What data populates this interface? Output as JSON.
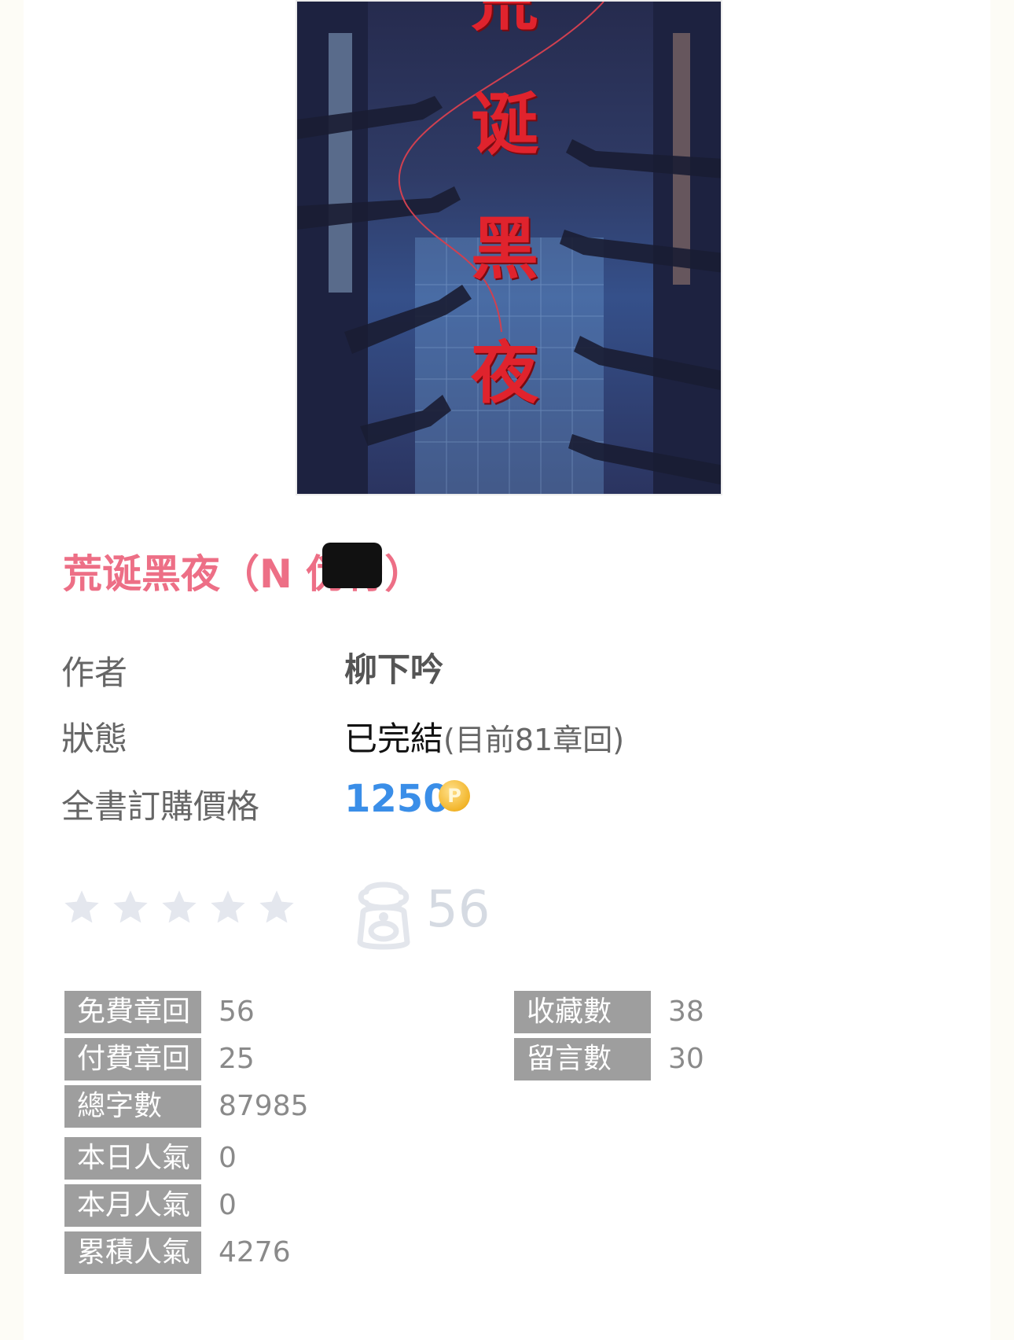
{
  "book": {
    "cover_title_chars": [
      "荒",
      "诞",
      "黑",
      "夜"
    ],
    "title": "荒诞黑夜（N 伪骨）"
  },
  "info": {
    "author_label": "作者",
    "author": "柳下吟",
    "status_label": "狀態",
    "status": "已完結",
    "status_detail": "(目前81章回)",
    "price_label": "全書訂購價格",
    "price": "1250",
    "coin_icon": "coin-icon",
    "coin_glyph": "P"
  },
  "rating": {
    "stars_filled": 0,
    "stars_total": 5,
    "favorite_count": "56"
  },
  "stats": {
    "left": [
      {
        "label": "免費章回",
        "value": "56"
      },
      {
        "label": "付費章回",
        "value": "25"
      },
      {
        "label": "總字數",
        "value": "87985"
      },
      {
        "label": "本日人氣",
        "value": "0"
      },
      {
        "label": "本月人氣",
        "value": "0"
      },
      {
        "label": "累積人氣",
        "value": "4276"
      }
    ],
    "right": [
      {
        "label": "收藏數",
        "value": "38"
      },
      {
        "label": "留言數",
        "value": "30"
      }
    ]
  },
  "colors": {
    "title": "#ed6f86",
    "price": "#3a8ee8",
    "stat_label_bg": "#9e9e9e",
    "star_empty": "#e4e7ee"
  }
}
